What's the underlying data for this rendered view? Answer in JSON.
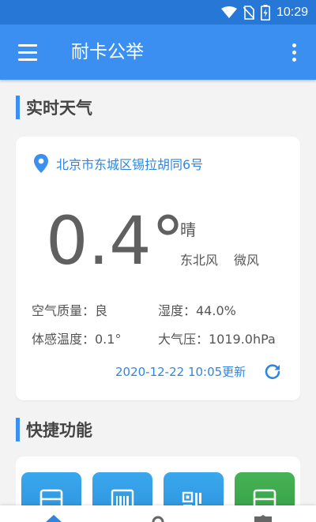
{
  "status_bar": {
    "time": "10:29",
    "icons": [
      "wifi-icon",
      "no-sim-icon",
      "battery-charging-icon"
    ]
  },
  "app_bar": {
    "title": "耐卡公举",
    "left_icon": "menu-icon",
    "right_icon": "more-vert-icon"
  },
  "sections": {
    "weather_title": "实时天气",
    "shortcuts_title": "快捷功能"
  },
  "weather": {
    "location": "北京市东城区锡拉胡同6号",
    "temperature": "0.4°",
    "condition": "晴",
    "wind_direction": "东北风",
    "wind_level": "微风",
    "air_quality": "空气质量：良",
    "humidity": "湿度：44.0%",
    "feels_like": "体感温度：0.1°",
    "pressure": "大气压：1019.0hPa",
    "updated": "2020-12-22 10:05更新",
    "refresh_icon": "refresh-icon"
  },
  "shortcuts": [
    {
      "icon": "bus-card-icon",
      "color": "#2f9de6"
    },
    {
      "icon": "barcode-icon",
      "color": "#2f9de6"
    },
    {
      "icon": "qrcode-icon",
      "color": "#2f9de6"
    },
    {
      "icon": "card-icon",
      "color": "#3aa548"
    }
  ],
  "colors": {
    "status_bar": "#2778d6",
    "app_bar": "#3a8ff0",
    "accent": "#2f86e2",
    "background": "#f3f3f3"
  }
}
